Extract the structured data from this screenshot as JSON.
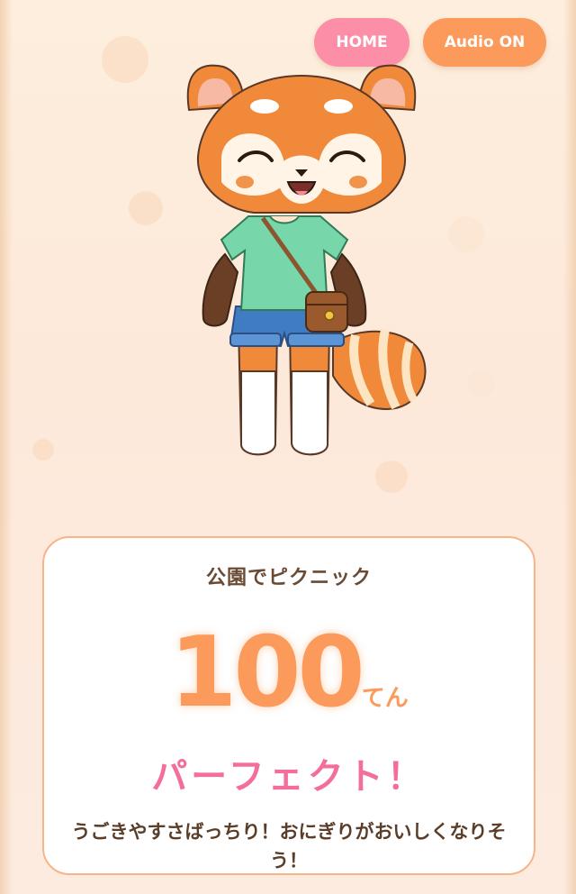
{
  "header": {
    "home_label": "HOME",
    "audio_label": "Audio ON"
  },
  "result": {
    "title": "公園でピクニック",
    "score": "100",
    "score_unit": "てん",
    "rating": "パーフェクト！",
    "comment": "うごきやすさばっちり！おにぎりがおいしくなりそう！"
  },
  "colors": {
    "home_button": "#fc8fa7",
    "audio_button": "#fb9a5a",
    "score": "#fb9a5a",
    "rating": "#f46e9c",
    "card_border": "#f7b488"
  },
  "character": {
    "icon": "red-panda-character",
    "outfit": [
      "mint-tshirt",
      "denim-shorts",
      "brown-crossbody-bag",
      "white-socks"
    ]
  }
}
